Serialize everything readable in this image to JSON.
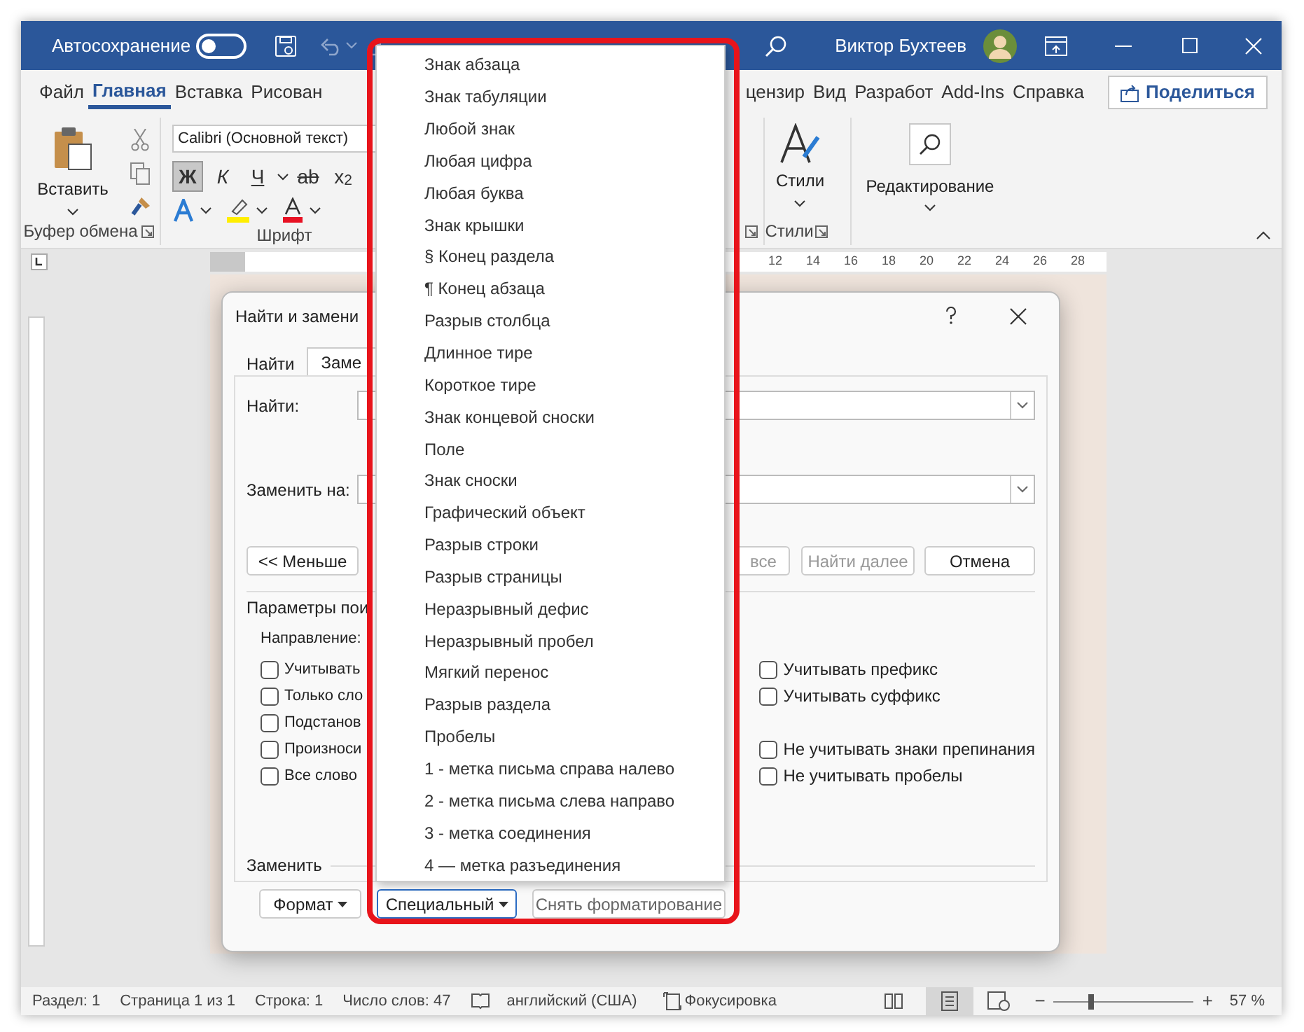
{
  "title_bar": {
    "autosave_label": "Автосохранение",
    "autosave_on": false,
    "user_name": "Виктор Бухтеев"
  },
  "ribbon_tabs": [
    {
      "label": "Файл",
      "selected": false
    },
    {
      "label": "Главная",
      "selected": true
    },
    {
      "label": "Вставка",
      "selected": false
    },
    {
      "label": "Рисован",
      "selected": false
    },
    {
      "label": "цензир",
      "selected": false
    },
    {
      "label": "Вид",
      "selected": false
    },
    {
      "label": "Разработ",
      "selected": false
    },
    {
      "label": "Add-Ins",
      "selected": false
    },
    {
      "label": "Справка",
      "selected": false
    }
  ],
  "share_button": "Поделиться",
  "ribbon": {
    "paste_label": "Вставить",
    "clipboard_group": "Буфер обмена",
    "font_name": "Calibri (Основной текст)",
    "font_buttons": [
      {
        "label": "Ж",
        "kind": "bold",
        "pressed": true
      },
      {
        "label": "К",
        "kind": "italic",
        "pressed": false
      },
      {
        "label": "Ч",
        "kind": "underline",
        "pressed": false
      },
      {
        "label": "ab",
        "kind": "strike",
        "pressed": false
      },
      {
        "label": "x$_{2}$",
        "kind": "sub",
        "pressed": false
      }
    ],
    "font_group": "Шрифт",
    "styles_label": "Стили",
    "styles_group": "Стили",
    "editing_label": "Редактирование"
  },
  "ruler": {
    "numbers": [
      "12",
      "14",
      "16",
      "18",
      "20",
      "22",
      "24",
      "26",
      "28"
    ]
  },
  "dialog": {
    "title": "Найти и замени",
    "tabs": [
      {
        "label": "Найти",
        "selected": false
      },
      {
        "label": "Заме",
        "selected": true
      }
    ],
    "find_label": "Найти:",
    "replace_label": "Заменить на:",
    "less_button": "<< Меньше",
    "replace_all_button": "все",
    "find_next_button": {
      "label": "Найти далее",
      "disabled": true
    },
    "cancel_button": "Отмена",
    "options_label": "Параметры пои",
    "direction_label": "Направление:",
    "left_options": [
      {
        "label": "Учитывать",
        "checked": false
      },
      {
        "label": "Только сло",
        "checked": false
      },
      {
        "label": "Подстанов",
        "checked": false
      },
      {
        "label": "Произноси",
        "checked": false
      },
      {
        "label": "Все слово",
        "checked": false
      }
    ],
    "right_options": [
      {
        "label": "Учитывать префикс",
        "checked": false
      },
      {
        "label": "Учитывать суффикс",
        "checked": false
      },
      {
        "label": "Не учитывать знаки препинания",
        "checked": false
      },
      {
        "label": "Не учитывать пробелы",
        "checked": false
      }
    ],
    "replace_section": "Заменить",
    "format_button": "Формат",
    "special_button": "Специальный",
    "clear_button": "Снять форматирование"
  },
  "special_menu": {
    "items": [
      "Знак абзаца",
      "Знак табуляции",
      "Любой знак",
      "Любая цифра",
      "Любая буква",
      "Знак крышки",
      "§ Конец раздела",
      "¶ Конец абзаца",
      "Разрыв столбца",
      "Длинное тире",
      "Короткое тире",
      "Знак концевой сноски",
      "Поле",
      "Знак сноски",
      "Графический объект",
      "Разрыв строки",
      "Разрыв страницы",
      "Неразрывный дефис",
      "Неразрывный пробел",
      "Мягкий перенос",
      "Разрыв раздела",
      "Пробелы",
      "1 - метка письма справа налево",
      "2 - метка письма слева направо",
      "3 - метка соединения",
      "4 — метка разъединения"
    ]
  },
  "status_bar": {
    "section": "Раздел: 1",
    "page": "Страница 1 из 1",
    "line": "Строка: 1",
    "words": "Число слов: 47",
    "language": "английский (США)",
    "focus": "Фокусировка",
    "zoom_out": "−",
    "zoom_in": "+",
    "zoom": {
      "level": 0.27,
      "reading": "57 %"
    }
  }
}
